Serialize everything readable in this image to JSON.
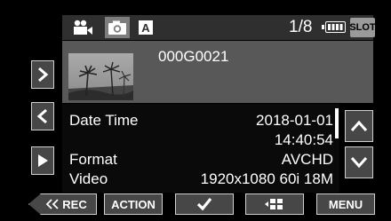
{
  "top_bar": {
    "file_count": "1/8",
    "slot_label": "SLOT",
    "auto_label": "A",
    "icons": [
      "video-mode-icon",
      "photo-mode-icon",
      "auto-mode-icon",
      "battery-icon"
    ]
  },
  "file": {
    "name": "000G0021"
  },
  "details": {
    "date_label": "Date Time",
    "date_value": "2018-01-01",
    "time_value": "14:40:54",
    "format_label": "Format",
    "format_value": "AVCHD",
    "video_label": "Video",
    "video_value": "1920x1080 60i 18M"
  },
  "bottom_bar": {
    "rec_label": "REC",
    "action_label": "ACTION",
    "menu_label": "MENU"
  },
  "colors": {
    "background": "#000000",
    "bar": "#2f2f2f",
    "thumb_row": "#585858",
    "button": "#474747",
    "button_border": "#cfcfcf"
  }
}
